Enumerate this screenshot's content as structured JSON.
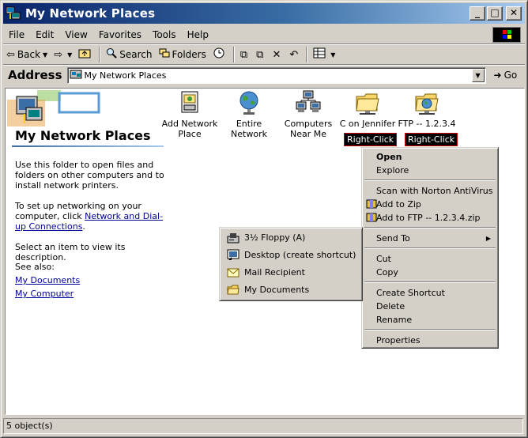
{
  "window": {
    "title": "My Network Places",
    "buttons": {
      "minimize": "_",
      "maximize": "□",
      "close": "✕"
    }
  },
  "menubar": [
    "File",
    "Edit",
    "View",
    "Favorites",
    "Tools",
    "Help"
  ],
  "toolbar": {
    "back": "Back",
    "search": "Search",
    "folders": "Folders"
  },
  "address": {
    "label": "Address",
    "value": "My Network Places",
    "go": "Go"
  },
  "left_pane": {
    "title": "My Network Places",
    "desc1": "Use this folder to open files and folders on other computers and to install network printers.",
    "desc2_prefix": "To set up networking on your computer, click ",
    "desc2_link": "Network and Dial-up Connections",
    "desc2_suffix": ".",
    "desc3": "Select an item to view its description.",
    "see_also": "See also:",
    "links": [
      "My Documents",
      "My Computer"
    ]
  },
  "icons": [
    {
      "label": "Add Network Place",
      "icon": "add-network-place-icon"
    },
    {
      "label": "Entire Network",
      "icon": "globe-icon"
    },
    {
      "label": "Computers Near Me",
      "icon": "computers-icon"
    },
    {
      "label": "C on Jennifer",
      "icon": "network-folder-icon"
    },
    {
      "label": "FTP -- 1.2.3.4",
      "icon": "ftp-folder-icon"
    }
  ],
  "annotations": [
    "Right-Click",
    "Right-Click"
  ],
  "context_menu": {
    "items": [
      "Open",
      "Explore",
      "Scan with Norton AntiVirus",
      "Add to Zip",
      "Add to FTP -- 1.2.3.4.zip",
      "Send To",
      "Cut",
      "Copy",
      "Create Shortcut",
      "Delete",
      "Rename",
      "Properties"
    ],
    "submenu_arrow": "▶"
  },
  "send_to_menu": [
    "3½ Floppy (A)",
    "Desktop (create shortcut)",
    "Mail Recipient",
    "My Documents"
  ],
  "status": {
    "text": "5 object(s)"
  },
  "colors": {
    "titlebar_start": "#0a246a",
    "titlebar_end": "#a6caf0",
    "face": "#d4d0c8",
    "link": "#00009c"
  }
}
